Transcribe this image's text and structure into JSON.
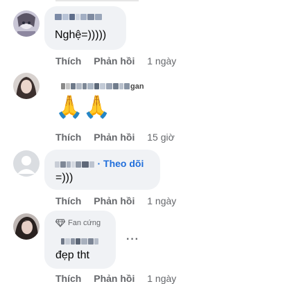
{
  "comments": [
    {
      "body": "Nghệ=)))))",
      "actions": {
        "like": "Thích",
        "reply": "Phản hồi",
        "time": "1 ngày"
      }
    },
    {
      "emoji": "🙏🙏",
      "actions": {
        "like": "Thích",
        "reply": "Phản hồi",
        "time": "15 giờ"
      }
    },
    {
      "follow_label": "· Theo dõi",
      "body": "=)))",
      "actions": {
        "like": "Thích",
        "reply": "Phản hồi",
        "time": "1 ngày"
      }
    },
    {
      "badge": "Fan cứng",
      "body": "đẹp tht",
      "more": "···",
      "actions": {
        "like": "Thích",
        "reply": "Phản hồi",
        "time": "1 ngày"
      }
    }
  ],
  "colors": {
    "bubble": "#f0f2f5",
    "meta": "#65676b",
    "link": "#216fdb"
  }
}
